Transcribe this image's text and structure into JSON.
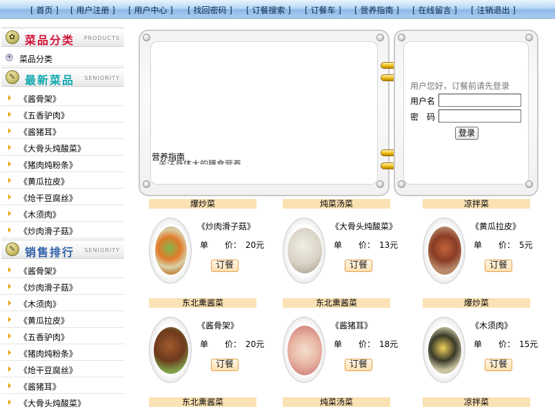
{
  "nav": [
    "[ 首页 ]",
    "[ 用户注册 ]",
    "[ 用户中心 ]",
    "[ 找回密码 ]",
    "[ 订餐搜索 ]",
    "[ 订餐车 ]",
    "[ 营养指南 ]",
    "[ 在线留言 ]",
    "[ 注销退出 ]"
  ],
  "sidebar": {
    "categories_head": {
      "title": "菜品分类",
      "sub": "PRODUCTS"
    },
    "categories_item": "菜品分类",
    "newest_head": {
      "title": "最新菜品",
      "sub": "SENIORITY"
    },
    "newest": [
      "《酱骨架》",
      "《五香驴肉》",
      "《酱猪耳》",
      "《大骨头炖酸菜》",
      "《猪肉炖粉条》",
      "《黄瓜拉皮》",
      "《炝干豆腐丝》",
      "《木须肉》",
      "《炒肉滑子菇》"
    ],
    "ranking_head": {
      "title": "销售排行",
      "sub": "SENIORITY"
    },
    "ranking": [
      "《酱骨架》",
      "《炒肉滑子菇》",
      "《木须肉》",
      "《黄瓜拉皮》",
      "《五香驴肉》",
      "《猪肉炖粉条》",
      "《炝干豆腐丝》",
      "《酱猪耳》",
      "《大骨头炖酸菜》"
    ]
  },
  "news": {
    "label": "营养指南",
    "scroll_text": "关注身体大的膳食营养"
  },
  "login": {
    "hint": "用户您好，订餐前请先登录",
    "username_label": "用户名",
    "password_label": "密　码",
    "username_value": "",
    "password_value": "",
    "button": "登录"
  },
  "dishes": {
    "price_label": "单　　价：",
    "order_label": "订餐",
    "row_categories": [
      [
        "爆炒菜",
        "炖菜汤菜",
        "凉拌菜"
      ],
      [
        "东北熏酱菜",
        "东北熏酱菜",
        "爆炒菜"
      ],
      [
        "东北熏酱菜",
        "炖菜汤菜",
        "凉拌菜"
      ]
    ],
    "rows": [
      [
        {
          "name": "《炒肉滑子菇》",
          "price": "20元"
        },
        {
          "name": "《大骨头炖酸菜》",
          "price": "13元"
        },
        {
          "name": "《黄瓜拉皮》",
          "price": "5元"
        }
      ],
      [
        {
          "name": "《酱骨架》",
          "price": "20元"
        },
        {
          "name": "《酱猪耳》",
          "price": "18元"
        },
        {
          "name": "《木须肉》",
          "price": "15元"
        }
      ]
    ]
  },
  "colors": {
    "nav_gradient_mid": "#b9d7f5",
    "category_bar": "#fbe2b5",
    "order_button_border": "#e3a04a",
    "ring_gold": "#f1c21b"
  }
}
